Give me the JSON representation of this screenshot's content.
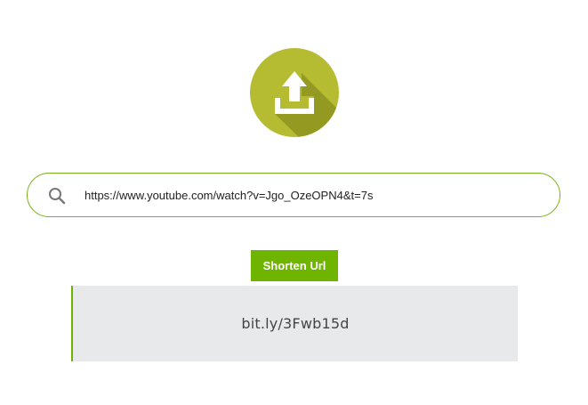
{
  "logo": {
    "icon": "upload-tray-icon",
    "color": "#b5bc31",
    "shadow_color": "#8d931f"
  },
  "search": {
    "icon": "search-icon",
    "value": "https://www.youtube.com/watch?v=Jgo_OzeOPN4&t=7s",
    "border_color": "#7ab317"
  },
  "actions": {
    "shorten_label": "Shorten Url",
    "button_color": "#6fb500"
  },
  "result": {
    "short_url": "bit.ly/3Fwb15d",
    "background_color": "#e8e9eb"
  }
}
